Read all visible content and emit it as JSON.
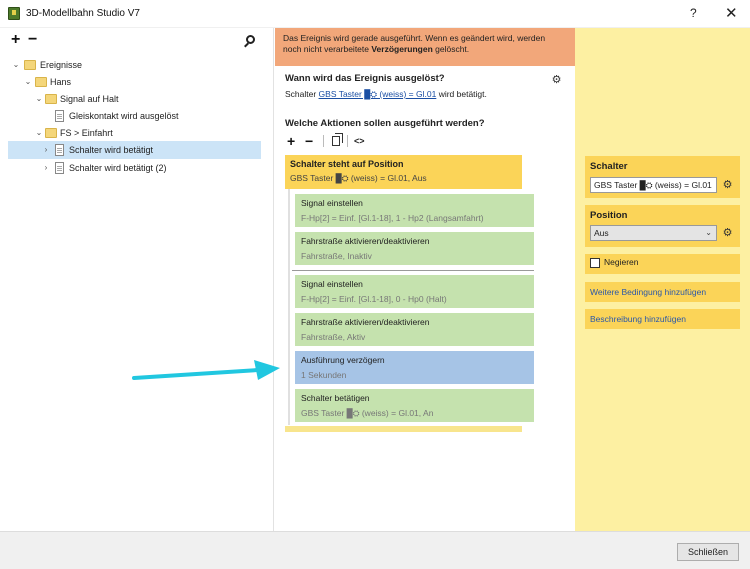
{
  "window": {
    "title": "3D-Modellbahn Studio V7",
    "help": "?",
    "close": "✕"
  },
  "tree_toolbar": {
    "add": "+",
    "remove": "−"
  },
  "tree": {
    "nodes": [
      {
        "label": "Ereignisse",
        "type": "folder",
        "chevron": "⌄"
      },
      {
        "label": "Hans",
        "type": "folder",
        "chevron": "⌄"
      },
      {
        "label": "Signal auf Halt",
        "type": "folder",
        "chevron": "⌄"
      },
      {
        "label": "Gleiskontakt wird ausgelöst",
        "type": "doc",
        "chevron": ""
      },
      {
        "label": "FS > Einfahrt",
        "type": "folder",
        "chevron": "⌄"
      },
      {
        "label": "Schalter wird betätigt",
        "type": "doc",
        "chevron": "›"
      },
      {
        "label": "Schalter wird betätigt (2)",
        "type": "doc",
        "chevron": "›"
      }
    ]
  },
  "warning": {
    "line1": "Das Ereignis wird gerade ausgeführt. Wenn es geändert wird, werden",
    "line2_pre": "noch nicht verarbeitete ",
    "line2_bold": "Verzögerungen",
    "line2_post": " gelöscht."
  },
  "trigger": {
    "question": "Wann wird das Ereignis ausgelöst?",
    "prefix": "Schalter ",
    "link": "GBS Taster █⛭ (weiss) = Gl.01",
    "suffix": " wird betätigt."
  },
  "actions_section": {
    "question": "Welche Aktionen sollen ausgeführt werden?",
    "add": "+",
    "remove": "−",
    "code": "<>"
  },
  "condition": {
    "title": "Schalter steht auf Position",
    "subtitle": "GBS Taster █⛭ (weiss) = Gl.01, Aus"
  },
  "actions": [
    {
      "title": "Signal einstellen",
      "sub": "F-Hp[2] = Einf. [Gl.1-18], 1 - Hp2 (Langsamfahrt)",
      "color": "green"
    },
    {
      "title": "Fahrstraße aktivieren/deaktivieren",
      "sub": "Fahrstraße, Inaktiv",
      "color": "green"
    },
    {
      "title": "Signal einstellen",
      "sub": "F-Hp[2] = Einf. [Gl.1-18], 0 - Hp0 (Halt)",
      "color": "green"
    },
    {
      "title": "Fahrstraße aktivieren/deaktivieren",
      "sub": "Fahrstraße, Aktiv",
      "color": "green"
    },
    {
      "title": "Ausführung verzögern",
      "sub": "1 Sekunden",
      "color": "blue"
    },
    {
      "title": "Schalter betätigen",
      "sub": "GBS Taster █⛭ (weiss) = Gl.01, An",
      "color": "green"
    }
  ],
  "properties": {
    "schalter_title": "Schalter",
    "schalter_value": "GBS Taster █⛭ (weiss) = Gl.01",
    "position_title": "Position",
    "position_value": "Aus",
    "negieren_label": "Negieren",
    "add_condition": "Weitere Bedingung hinzufügen",
    "add_description": "Beschreibung hinzufügen"
  },
  "footer": {
    "close_label": "Schließen"
  },
  "colors": {
    "warning": "#f2a77a",
    "condition": "#fbd458",
    "action_green": "#c5e2ae",
    "action_blue": "#a6c4e6",
    "right_panel": "#fdf0a2",
    "selection": "#cce4f7",
    "arrow": "#21c7e0"
  }
}
